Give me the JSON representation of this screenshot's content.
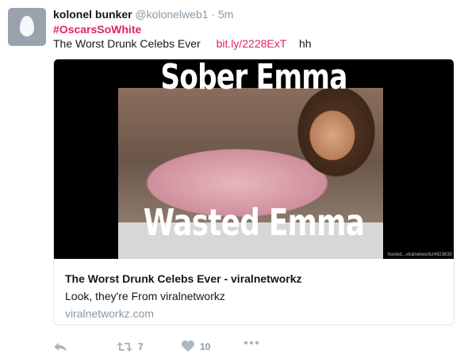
{
  "tweet": {
    "name": "kolonel bunker",
    "handle": "@kolonelweb1",
    "separator": "·",
    "time": "5m",
    "hashtag": "#OscarsSoWhite",
    "text": "The Worst Drunk Celebs Ever",
    "link": "bit.ly/2228ExT",
    "tail": "hh"
  },
  "card": {
    "meme_top": "Sober Emma",
    "meme_bottom": "Wasted Emma",
    "watermark": "hosted...viralnetworkz4923630",
    "title": "The Worst Drunk Celebs Ever - viralnetworkz",
    "description": "Look, they're From viralnetworkz",
    "domain": "viralnetworkz.com"
  },
  "actions": {
    "retweet_count": "7",
    "like_count": "10"
  },
  "colors": {
    "accent": "#e0245e",
    "muted": "#8899a6",
    "icon": "#aab8c2"
  }
}
